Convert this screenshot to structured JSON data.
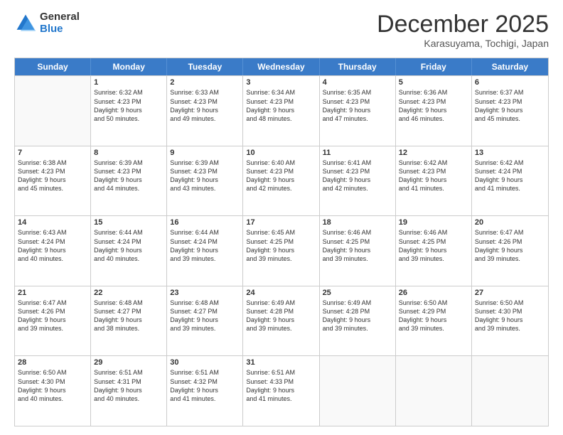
{
  "logo": {
    "general": "General",
    "blue": "Blue"
  },
  "header": {
    "title": "December 2025",
    "subtitle": "Karasuyama, Tochigi, Japan"
  },
  "weekdays": [
    "Sunday",
    "Monday",
    "Tuesday",
    "Wednesday",
    "Thursday",
    "Friday",
    "Saturday"
  ],
  "weeks": [
    [
      {
        "day": "",
        "info": ""
      },
      {
        "day": "1",
        "info": "Sunrise: 6:32 AM\nSunset: 4:23 PM\nDaylight: 9 hours\nand 50 minutes."
      },
      {
        "day": "2",
        "info": "Sunrise: 6:33 AM\nSunset: 4:23 PM\nDaylight: 9 hours\nand 49 minutes."
      },
      {
        "day": "3",
        "info": "Sunrise: 6:34 AM\nSunset: 4:23 PM\nDaylight: 9 hours\nand 48 minutes."
      },
      {
        "day": "4",
        "info": "Sunrise: 6:35 AM\nSunset: 4:23 PM\nDaylight: 9 hours\nand 47 minutes."
      },
      {
        "day": "5",
        "info": "Sunrise: 6:36 AM\nSunset: 4:23 PM\nDaylight: 9 hours\nand 46 minutes."
      },
      {
        "day": "6",
        "info": "Sunrise: 6:37 AM\nSunset: 4:23 PM\nDaylight: 9 hours\nand 45 minutes."
      }
    ],
    [
      {
        "day": "7",
        "info": "Sunrise: 6:38 AM\nSunset: 4:23 PM\nDaylight: 9 hours\nand 45 minutes."
      },
      {
        "day": "8",
        "info": "Sunrise: 6:39 AM\nSunset: 4:23 PM\nDaylight: 9 hours\nand 44 minutes."
      },
      {
        "day": "9",
        "info": "Sunrise: 6:39 AM\nSunset: 4:23 PM\nDaylight: 9 hours\nand 43 minutes."
      },
      {
        "day": "10",
        "info": "Sunrise: 6:40 AM\nSunset: 4:23 PM\nDaylight: 9 hours\nand 42 minutes."
      },
      {
        "day": "11",
        "info": "Sunrise: 6:41 AM\nSunset: 4:23 PM\nDaylight: 9 hours\nand 42 minutes."
      },
      {
        "day": "12",
        "info": "Sunrise: 6:42 AM\nSunset: 4:23 PM\nDaylight: 9 hours\nand 41 minutes."
      },
      {
        "day": "13",
        "info": "Sunrise: 6:42 AM\nSunset: 4:24 PM\nDaylight: 9 hours\nand 41 minutes."
      }
    ],
    [
      {
        "day": "14",
        "info": "Sunrise: 6:43 AM\nSunset: 4:24 PM\nDaylight: 9 hours\nand 40 minutes."
      },
      {
        "day": "15",
        "info": "Sunrise: 6:44 AM\nSunset: 4:24 PM\nDaylight: 9 hours\nand 40 minutes."
      },
      {
        "day": "16",
        "info": "Sunrise: 6:44 AM\nSunset: 4:24 PM\nDaylight: 9 hours\nand 39 minutes."
      },
      {
        "day": "17",
        "info": "Sunrise: 6:45 AM\nSunset: 4:25 PM\nDaylight: 9 hours\nand 39 minutes."
      },
      {
        "day": "18",
        "info": "Sunrise: 6:46 AM\nSunset: 4:25 PM\nDaylight: 9 hours\nand 39 minutes."
      },
      {
        "day": "19",
        "info": "Sunrise: 6:46 AM\nSunset: 4:25 PM\nDaylight: 9 hours\nand 39 minutes."
      },
      {
        "day": "20",
        "info": "Sunrise: 6:47 AM\nSunset: 4:26 PM\nDaylight: 9 hours\nand 39 minutes."
      }
    ],
    [
      {
        "day": "21",
        "info": "Sunrise: 6:47 AM\nSunset: 4:26 PM\nDaylight: 9 hours\nand 39 minutes."
      },
      {
        "day": "22",
        "info": "Sunrise: 6:48 AM\nSunset: 4:27 PM\nDaylight: 9 hours\nand 38 minutes."
      },
      {
        "day": "23",
        "info": "Sunrise: 6:48 AM\nSunset: 4:27 PM\nDaylight: 9 hours\nand 39 minutes."
      },
      {
        "day": "24",
        "info": "Sunrise: 6:49 AM\nSunset: 4:28 PM\nDaylight: 9 hours\nand 39 minutes."
      },
      {
        "day": "25",
        "info": "Sunrise: 6:49 AM\nSunset: 4:28 PM\nDaylight: 9 hours\nand 39 minutes."
      },
      {
        "day": "26",
        "info": "Sunrise: 6:50 AM\nSunset: 4:29 PM\nDaylight: 9 hours\nand 39 minutes."
      },
      {
        "day": "27",
        "info": "Sunrise: 6:50 AM\nSunset: 4:30 PM\nDaylight: 9 hours\nand 39 minutes."
      }
    ],
    [
      {
        "day": "28",
        "info": "Sunrise: 6:50 AM\nSunset: 4:30 PM\nDaylight: 9 hours\nand 40 minutes."
      },
      {
        "day": "29",
        "info": "Sunrise: 6:51 AM\nSunset: 4:31 PM\nDaylight: 9 hours\nand 40 minutes."
      },
      {
        "day": "30",
        "info": "Sunrise: 6:51 AM\nSunset: 4:32 PM\nDaylight: 9 hours\nand 41 minutes."
      },
      {
        "day": "31",
        "info": "Sunrise: 6:51 AM\nSunset: 4:33 PM\nDaylight: 9 hours\nand 41 minutes."
      },
      {
        "day": "",
        "info": ""
      },
      {
        "day": "",
        "info": ""
      },
      {
        "day": "",
        "info": ""
      }
    ]
  ]
}
